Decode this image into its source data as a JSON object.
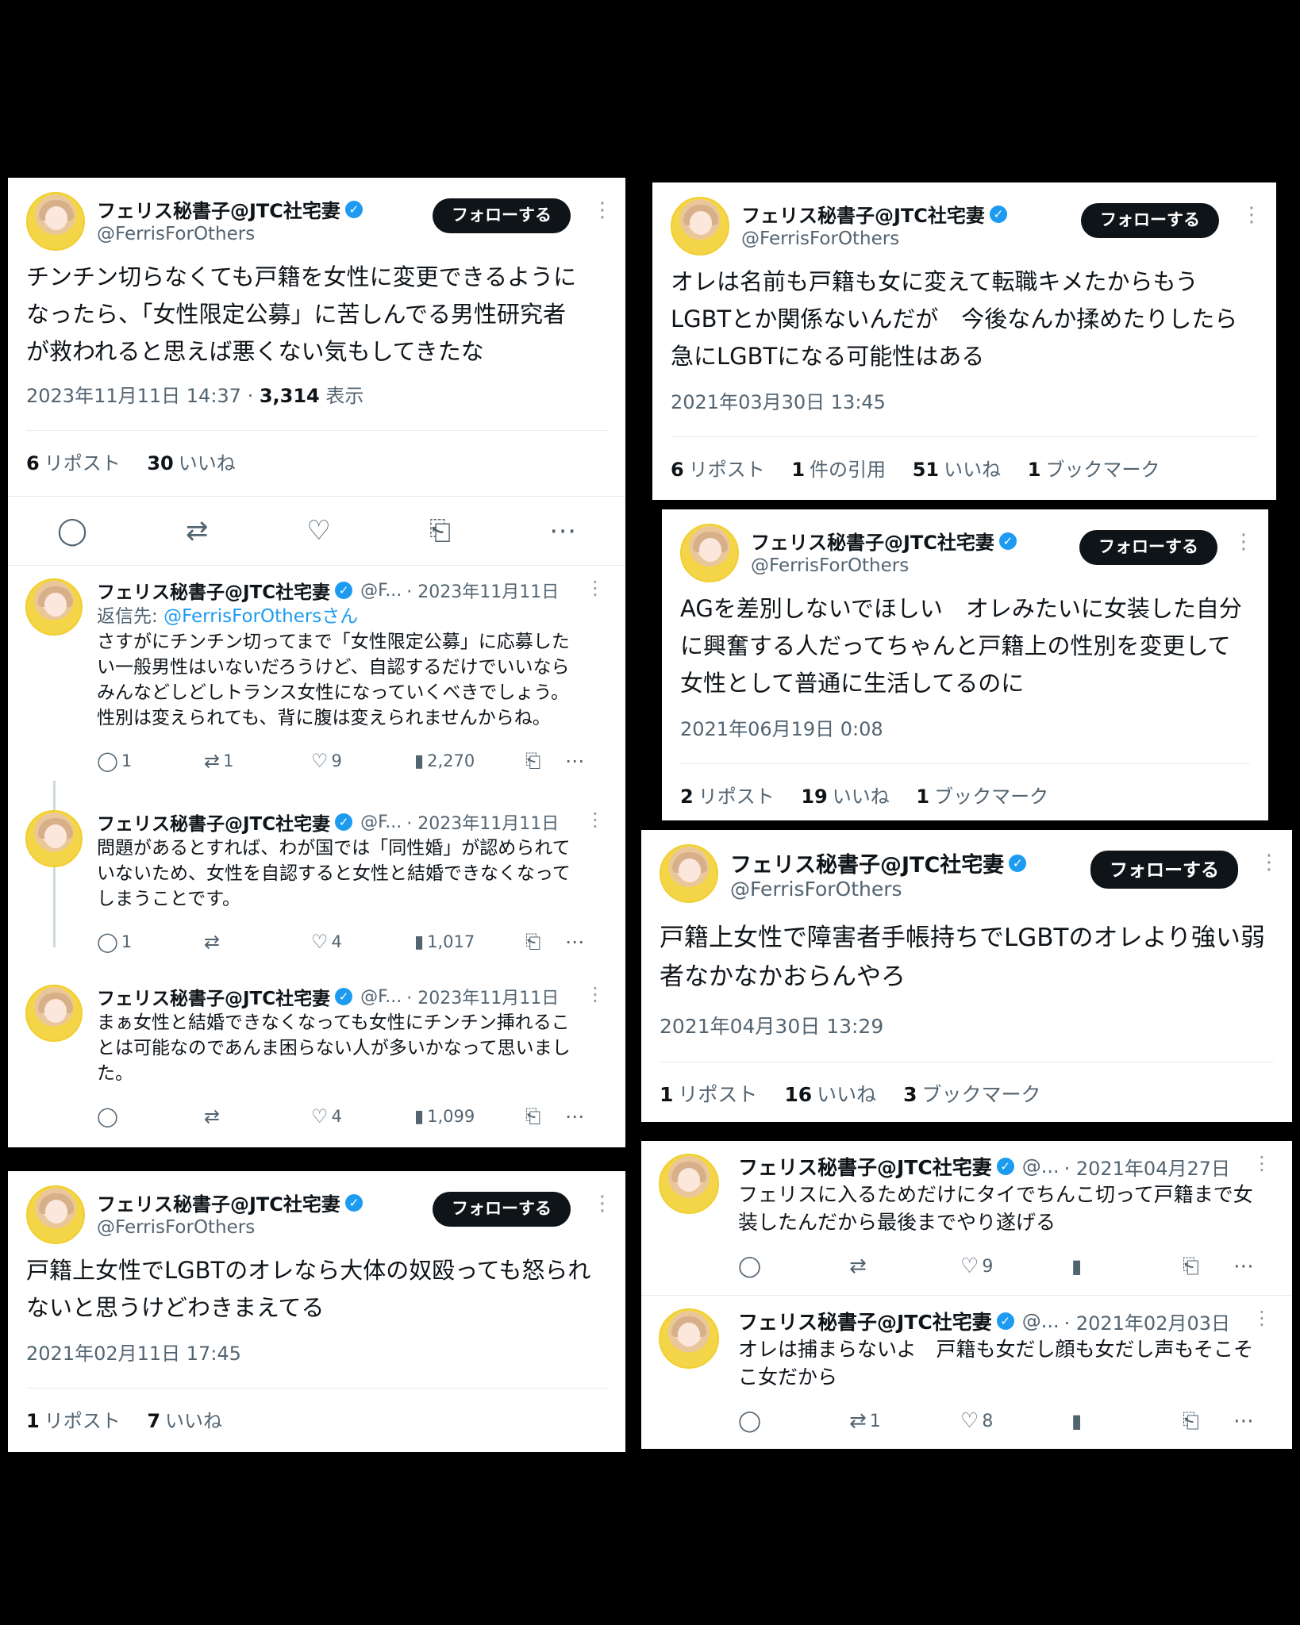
{
  "user": {
    "name": "フェリス秘書子@JTC社宅妻",
    "handle": "@FerrisForOthers",
    "handle_short": "@F...",
    "handle_short2": "@...",
    "follow_label": "フォローする",
    "verified_glyph": "✓"
  },
  "post1": {
    "text": "チンチン切らなくても戸籍を女性に変更できるように\nなったら、「女性限定公募」に苦しんでる男性研究者\nが救われると思えば悪くない気もしてきたな",
    "date": "2023年11月11日 14:37 · ",
    "views": "3,314",
    "views_label": " 表示",
    "reposts": "6",
    "reposts_label": "リポスト",
    "likes": "30",
    "likes_label": "いいね"
  },
  "replies": [
    {
      "date": "· 2023年11月11日",
      "reply_to_label": "返信先: ",
      "reply_to": "@FerrisForOthersさん",
      "text": "さすがにチンチン切ってまで「女性限定公募」に応募した\nい一般男性はいないだろうけど、自認するだけでいいなら\nみんなどしどしトランス女性になっていくべきでしょう。\n性別は変えられても、背に腹は変えられませんからね。",
      "replies": "1",
      "reposts": "1",
      "likes": "9",
      "views": "2,270"
    },
    {
      "date": "· 2023年11月11日",
      "text": "問題があるとすれば、わが国では「同性婚」が認められて\nいないため、女性を自認すると女性と結婚できなくなって\nしまうことです。",
      "replies": "1",
      "reposts": "",
      "likes": "4",
      "views": "1,017"
    },
    {
      "date": "· 2023年11月11日",
      "text": "まぁ女性と結婚できなくなっても女性にチンチン挿れるこ\nとは可能なのであんま困らない人が多いかなって思いまし\nた。",
      "replies": "",
      "reposts": "",
      "likes": "4",
      "views": "1,099"
    }
  ],
  "post2": {
    "text": "戸籍上女性でLGBTのオレなら大体の奴殴っても怒られ\nないと思うけどわきまえてる",
    "date": "2021年02月11日 17:45",
    "reposts": "1",
    "reposts_label": "リポスト",
    "likes": "7",
    "likes_label": "いいね"
  },
  "post3": {
    "text": "オレは名前も戸籍も女に変えて転職キメたからもう\nLGBTとか関係ないんだが　今後なんか揉めたりしたら\n急にLGBTになる可能性はある",
    "date": "2021年03月30日 13:45",
    "reposts": "6",
    "reposts_label": "リポスト",
    "quotes": "1",
    "quotes_label": "件の引用",
    "likes": "51",
    "likes_label": "いいね",
    "bookmarks": "1",
    "bookmarks_label": "ブックマーク"
  },
  "post4": {
    "text": "AGを差別しないでほしい　オレみたいに女装した自分\nに興奮する人だってちゃんと戸籍上の性別を変更して\n女性として普通に生活してるのに",
    "date": "2021年06月19日 0:08",
    "reposts": "2",
    "reposts_label": "リポスト",
    "likes": "19",
    "likes_label": "いいね",
    "bookmarks": "1",
    "bookmarks_label": "ブックマーク"
  },
  "post5": {
    "text": "戸籍上女性で障害者手帳持ちでLGBTのオレより強い弱\n者なかなかおらんやろ",
    "date": "2021年04月30日 13:29",
    "reposts": "1",
    "reposts_label": "リポスト",
    "likes": "16",
    "likes_label": "いいね",
    "bookmarks": "3",
    "bookmarks_label": "ブックマーク"
  },
  "post6": {
    "date": "· 2021年04月27日",
    "text": "フェリスに入るためだけにタイでちんこ切って戸籍まで女\n装したんだから最後までやり遂げる",
    "likes": "9"
  },
  "post7": {
    "date": "· 2021年02月03日",
    "text": "オレは捕まらないよ　戸籍も女だし顔も女だし声もそこそ\nこ女だから",
    "reposts": "1",
    "likes": "8"
  }
}
